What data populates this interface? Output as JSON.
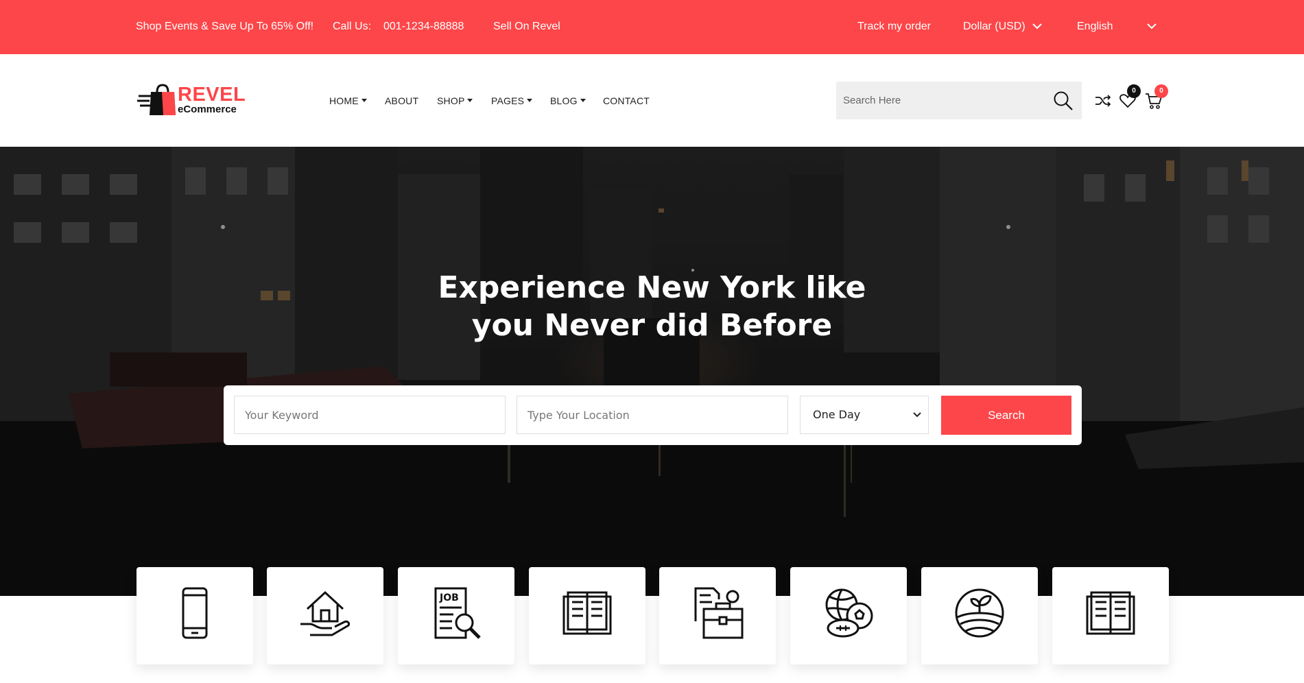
{
  "topbar": {
    "promo": "Shop Events & Save Up To 65% Off!",
    "call_label": "Call Us:",
    "phone": "001-1234-88888",
    "sell": "Sell On Revel",
    "track": "Track my order",
    "currency": "Dollar (USD)",
    "language": "English",
    "background_color": "#fd4649"
  },
  "logo": {
    "word": "REVEL",
    "sub": "eCommerce"
  },
  "nav": {
    "home": "HOME",
    "about": "ABOUT",
    "shop": "SHOP",
    "pages": "PAGES",
    "blog": "BLOG",
    "contact": "CONTACT"
  },
  "search": {
    "placeholder": "Search Here"
  },
  "header_icons": {
    "wishlist_count": "0",
    "cart_count": "0"
  },
  "hero": {
    "title_line1": "Experience New York like",
    "title_line2": "you Never did Before",
    "keyword_placeholder": "Your Keyword",
    "location_placeholder": "Type Your Location",
    "duration_selected": "One Day",
    "search_label": "Search"
  },
  "categories": [
    {
      "icon": "smartphone-icon"
    },
    {
      "icon": "home-in-hand-icon"
    },
    {
      "icon": "job-search-icon"
    },
    {
      "icon": "open-book-icon"
    },
    {
      "icon": "briefcase-settings-icon"
    },
    {
      "icon": "sports-balls-icon"
    },
    {
      "icon": "agriculture-icon"
    },
    {
      "icon": "open-book-icon"
    }
  ],
  "colors": {
    "accent": "#fd4649"
  }
}
